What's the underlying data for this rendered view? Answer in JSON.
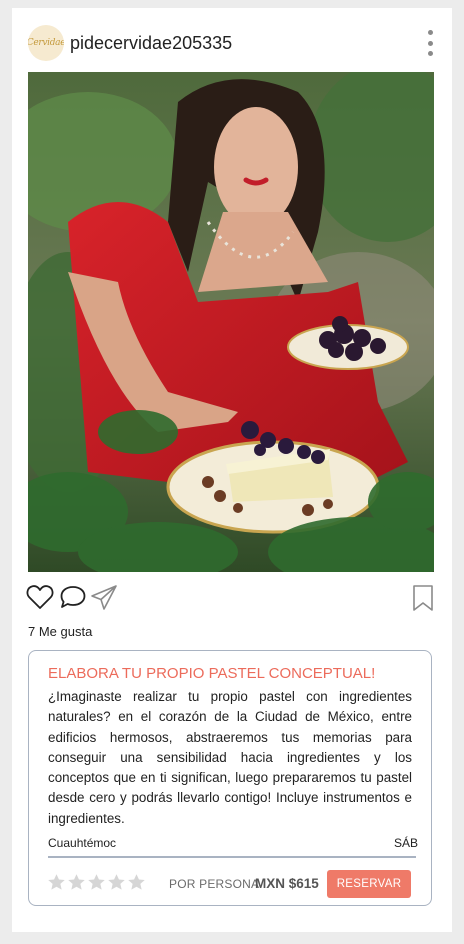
{
  "post": {
    "username": "pidecervidae205335",
    "avatar_text": "Cervidae",
    "likes_text": "7 Me gusta",
    "icons": [
      "heart-icon",
      "comment-icon",
      "share-icon",
      "bookmark-icon",
      "more-options-icon"
    ]
  },
  "experience": {
    "title": "ELABORA TU PROPIO PASTEL CONCEPTUAL!",
    "description": "¿Imaginaste realizar tu propio pastel con ingredientes naturales? en el corazón de la Ciudad de México, entre edificios hermosos, abstraeremos tus memorias para conseguir una sensibilidad hacia ingredientes y los conceptos que en ti significan, luego prepararemos tu pastel desde cero y podrás llevarlo contigo! Incluye instrumentos e ingredientes.",
    "location": "Cuauhtémoc",
    "day": "SÁB",
    "rating": 0,
    "rating_max": 5,
    "per_person_label": "POR PERSONA",
    "price": "MXN $615",
    "book_label": "RESERVAR"
  },
  "colors": {
    "accent": "#ef7a68",
    "title": "#ec6b5b",
    "border": "#a9b3c2",
    "star_empty": "#d6d6d6"
  }
}
